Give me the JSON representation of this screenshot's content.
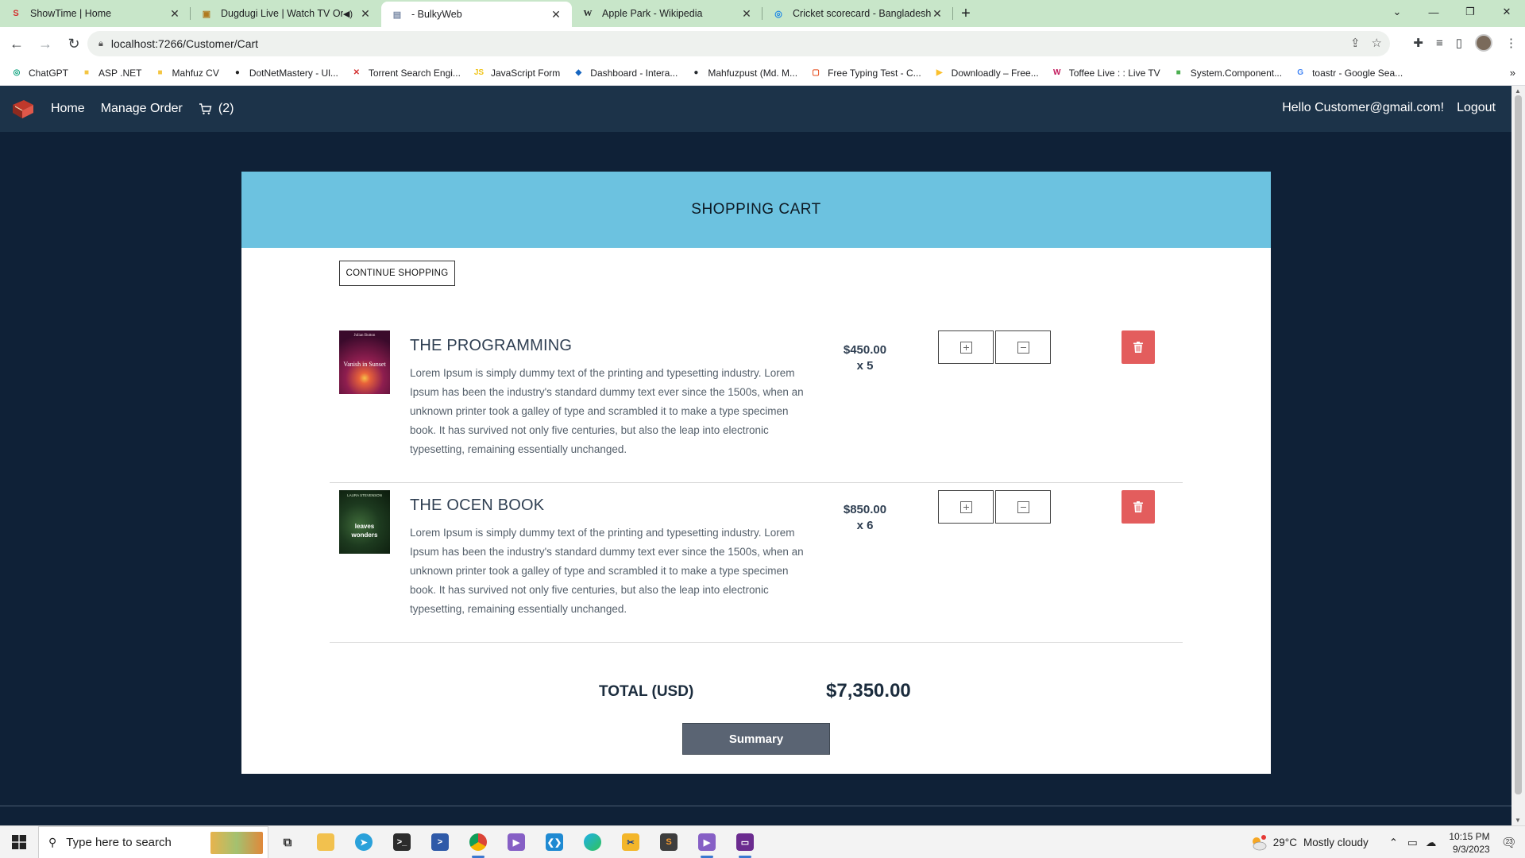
{
  "browser": {
    "tabs": [
      {
        "title": "ShowTime | Home",
        "icon": "showtime-icon",
        "active": false,
        "muted": false
      },
      {
        "title": "Dugdugi Live | Watch TV Onl",
        "icon": "tv-icon",
        "active": false,
        "muted": true
      },
      {
        "title": "- BulkyWeb",
        "icon": "page-icon",
        "active": true,
        "muted": false
      },
      {
        "title": "Apple Park - Wikipedia",
        "icon": "wikipedia-icon",
        "active": false,
        "muted": false
      },
      {
        "title": "Cricket scorecard - Bangladesh v",
        "icon": "cricket-icon",
        "active": false,
        "muted": false
      }
    ],
    "url": "localhost:7266/Customer/Cart",
    "bookmarks": [
      {
        "label": "ChatGPT",
        "icon": "chatgpt-icon",
        "color": "#10a37f"
      },
      {
        "label": "ASP .NET",
        "icon": "folder-icon",
        "color": "#f4c542"
      },
      {
        "label": "Mahfuz CV",
        "icon": "folder-icon",
        "color": "#f4c542"
      },
      {
        "label": "DotNetMastery - Ul...",
        "icon": "dotnetmastery-icon",
        "color": "#222222"
      },
      {
        "label": "Torrent Search Engi...",
        "icon": "torrent-icon",
        "color": "#d32f2f"
      },
      {
        "label": "JavaScript Form",
        "icon": "js-icon",
        "color": "#f0c419"
      },
      {
        "label": "Dashboard - Intera...",
        "icon": "dashboard-icon",
        "color": "#1565c0"
      },
      {
        "label": "Mahfuzpust (Md. M...",
        "icon": "github-icon",
        "color": "#24292e"
      },
      {
        "label": "Free Typing Test - C...",
        "icon": "typing-icon",
        "color": "#e64a19"
      },
      {
        "label": "Downloadly – Free...",
        "icon": "downloadly-icon",
        "color": "#fbc02d"
      },
      {
        "label": "Toffee Live : : Live TV",
        "icon": "toffee-icon",
        "color": "#c2185b"
      },
      {
        "label": "System.Component...",
        "icon": "microsoft-icon",
        "color": "#4caf50"
      },
      {
        "label": "toastr - Google Sea...",
        "icon": "google-icon",
        "color": "#4285f4"
      }
    ]
  },
  "nav": {
    "home": "Home",
    "manage_order": "Manage Order",
    "cart_count": "(2)",
    "greeting": "Hello Customer@gmail.com!",
    "logout": "Logout"
  },
  "cart": {
    "header": "SHOPPING CART",
    "continue_label": "CONTINUE SHOPPING",
    "items": [
      {
        "title": "THE PROGRAMMING",
        "description": "Lorem Ipsum is simply dummy text of the printing and typesetting industry. Lorem Ipsum has been the industry's standard dummy text ever since the 1500s, when an unknown printer took a galley of type and scrambled it to make a type specimen book. It has survived not only five centuries, but also the leap into electronic typesetting, remaining essentially unchanged.",
        "price": "$450.00",
        "quantity": "x 5",
        "cover_text": "Vanish in Sunset",
        "cover_author": "Julian Button"
      },
      {
        "title": "THE OCEN BOOK",
        "description": "Lorem Ipsum is simply dummy text of the printing and typesetting industry. Lorem Ipsum has been the industry's standard dummy text ever since the 1500s, when an unknown printer took a galley of type and scrambled it to make a type specimen book. It has survived not only five centuries, but also the leap into electronic typesetting, remaining essentially unchanged.",
        "price": "$850.00",
        "quantity": "x 6",
        "cover_text": "leaves wonders",
        "cover_author": "LAURA STEVENSON"
      }
    ],
    "total_label": "TOTAL (USD)",
    "total_value": "$7,350.00",
    "summary_label": "Summary"
  },
  "taskbar": {
    "search_placeholder": "Type here to search",
    "weather_temp": "29°C",
    "weather_desc": "Mostly cloudy",
    "time": "10:15 PM",
    "date": "9/3/2023",
    "notification_count": "23"
  },
  "colors": {
    "page_bg": "#0f2137",
    "navbar_bg": "#1c3349",
    "card_header": "#6cc2e0",
    "delete": "#e35d5d",
    "summary_btn": "#5a6473",
    "tabstrip": "#c8e6c9"
  }
}
